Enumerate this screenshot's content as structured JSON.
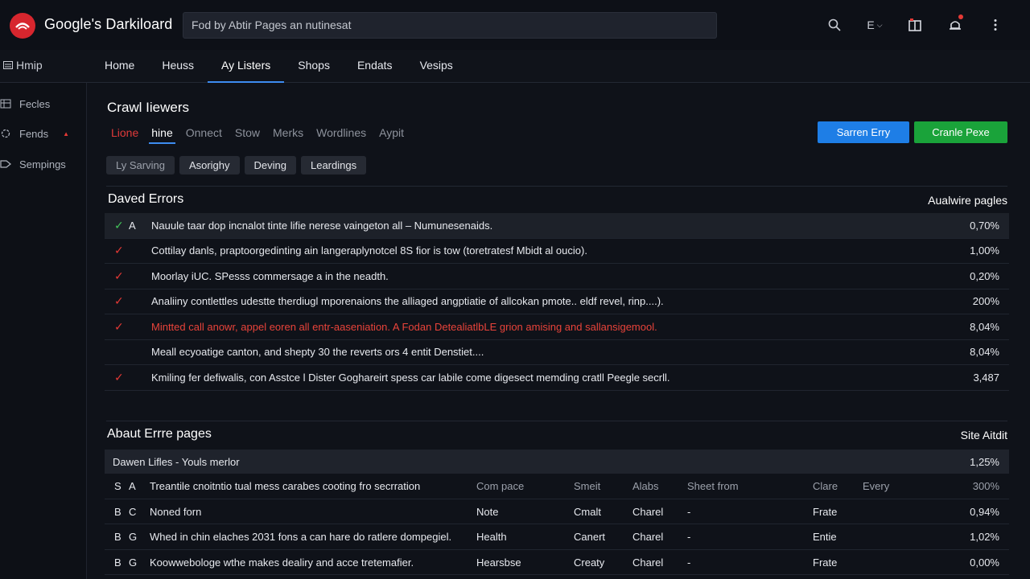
{
  "app": {
    "title": "Google's Darkiloard",
    "search_value": "Fod by Abtir Pages an nutinesat"
  },
  "top_icons": [
    "search-icon",
    "language-menu",
    "panel-icon",
    "notifications-icon",
    "more-vertical-icon"
  ],
  "top_icon_text": {
    "language": "E"
  },
  "nav": {
    "side_label": "Hmip",
    "tabs": [
      "Home",
      "Heuss",
      "Ay Listers",
      "Shops",
      "Endats",
      "Vesips"
    ],
    "active_tab": "Ay Listers"
  },
  "sidebar": {
    "items": [
      "Fecles",
      "Fends",
      "Sempings"
    ]
  },
  "crawl": {
    "title": "Crawl Iiewers",
    "subtabs": [
      "Lione",
      "hine",
      "Onnect",
      "Stow",
      "Merks",
      "Wordlines",
      "Aypit"
    ],
    "active_subtab": "hine",
    "red_subtab": "Lione",
    "btn_primary": "Sarren Erry",
    "btn_secondary": "Cranle Pexe",
    "chips": [
      "Ly Sarving",
      "Asorighy",
      "Deving",
      "Leardings"
    ]
  },
  "errors": {
    "title": "Daved Errors",
    "right_label": "Aualwire pagles",
    "rows": [
      {
        "letter": "A",
        "text": "Nauule taar dop incnalot tinte lifie nerese vaingeton all – Numunesenaids.",
        "pct": "0,70%",
        "check": "green",
        "highlight": true,
        "red": false
      },
      {
        "letter": "",
        "text": "Cottilay danls, praptoorgedinting ain langeraplynotcel 8S fior is tow (toretratesf Mbidt al oucio).",
        "pct": "1,00%",
        "check": "red",
        "highlight": false,
        "red": false
      },
      {
        "letter": "",
        "text": "Moorlay iUC. SPesss commersage a in the neadth.",
        "pct": "0,20%",
        "check": "red",
        "highlight": false,
        "red": false
      },
      {
        "letter": "",
        "text": "Analiiny contlettles udestte therdiugl mporenaions the alliaged angptiatie of allcokan pmote.. eldf revel, rinp....).",
        "pct": "200%",
        "check": "red",
        "highlight": false,
        "red": false
      },
      {
        "letter": "",
        "text": "Mintted call anowr, appel eoren all entr-aaseniation. A Fodan DetealiatlbLE grion amising and sallansigemool.",
        "pct": "8,04%",
        "check": "red",
        "highlight": false,
        "red": true
      },
      {
        "letter": "",
        "text": "Meall ecyoatige canton, and shepty 30 the reverts ors 4 entit Denstiet....",
        "pct": "8,04%",
        "check": "none",
        "highlight": false,
        "red": false
      },
      {
        "letter": "",
        "text": "Kmiling fer defiwalis, con Asstce l Dister Goghareirt spess car labile come digesect memding cratll Peegle secrll.",
        "pct": "3,487",
        "check": "red",
        "highlight": false,
        "red": false
      }
    ]
  },
  "pages": {
    "title": "Abaut Errre pages",
    "right_label": "Site Aitdit",
    "group_label": "Dawen Lifles - Youls merlor",
    "group_pct": "1,25%",
    "header": [
      "S",
      "A",
      "Treantile cnoitntio tual mess carabes cooting fro secrration",
      "Com pace",
      "Smeit",
      "Alabs",
      "Sheet from",
      "Clare",
      "Every",
      "300%"
    ],
    "rows": [
      [
        "B",
        "C",
        "Noned forn",
        "Note",
        "Cmalt",
        "Charel",
        "-",
        "Frate",
        "",
        "0,94%"
      ],
      [
        "B",
        "G",
        "Whed in chin elaches 2031 fons a can hare do ratlere dompegiel.",
        "Health",
        "Canert",
        "Charel",
        "-",
        "Entie",
        "",
        "1,02%"
      ],
      [
        "B",
        "G",
        "Koowwebologe wthe makes dealiry and acce tretemafier.",
        "Hearsbse",
        "Creaty",
        "Charel",
        "-",
        "Frate",
        "",
        "0,00%"
      ]
    ]
  }
}
